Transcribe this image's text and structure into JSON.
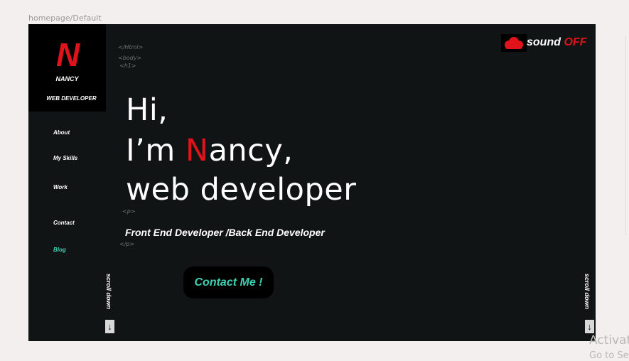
{
  "frame": {
    "label": "homepage/Default"
  },
  "logo": {
    "letter": "N",
    "name": "NANCY",
    "role": "WEB DEVELOPER"
  },
  "nav": [
    {
      "label": "About"
    },
    {
      "label": "My Skills"
    },
    {
      "label": "Work"
    },
    {
      "label": "Contact"
    },
    {
      "label": "Blog"
    }
  ],
  "code_tags": {
    "html_close": "</Html>",
    "body_open": "<body>",
    "h1_open": "<h1>",
    "p_open": "<p>",
    "p_close": "</p>"
  },
  "hero": {
    "line1": "Hi,",
    "line2_pre": "I’m ",
    "line2_accent": "N",
    "line2_post": "ancy,",
    "line3": "web developer"
  },
  "subtitle": "Front End Developer /Back End Developer",
  "contact_button": "Contact Me  !",
  "scroll": {
    "label": "scroll down",
    "arrow": "↓"
  },
  "sound": {
    "label": "sound",
    "state": "OFF",
    "icon": "cloud-icon"
  },
  "overlay": {
    "line1": "Activat",
    "line2": "Go to Se"
  },
  "colors": {
    "background": "#101414",
    "accent_red": "#e0121a",
    "accent_teal": "#3fd1b4"
  }
}
